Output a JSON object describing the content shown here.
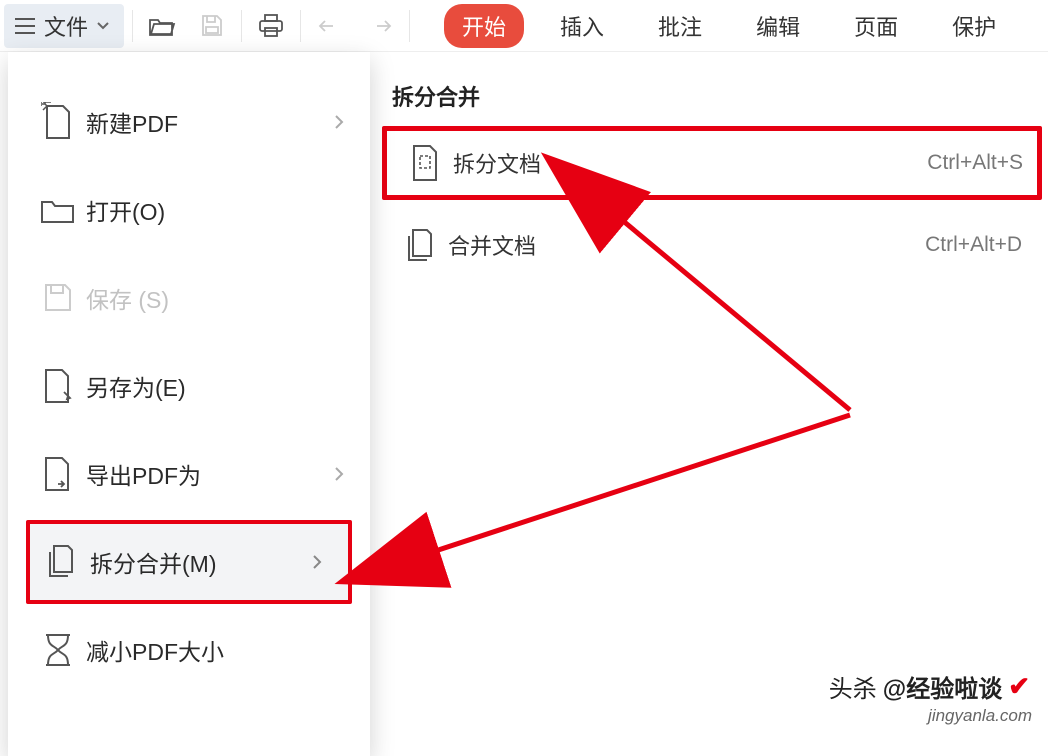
{
  "toolbar": {
    "file_label": "文件"
  },
  "tabs": {
    "start": "开始",
    "insert": "插入",
    "annotate": "批注",
    "edit": "编辑",
    "page": "页面",
    "protect": "保护"
  },
  "file_menu": {
    "new_pdf": "新建PDF",
    "open": "打开(O)",
    "save": "保存 (S)",
    "save_as": "另存为(E)",
    "export_as": "导出PDF为",
    "split_merge": "拆分合并(M)",
    "reduce_size": "减小PDF大小"
  },
  "submenu": {
    "title": "拆分合并",
    "split": {
      "label": "拆分文档",
      "shortcut": "Ctrl+Alt+S"
    },
    "merge": {
      "label": "合并文档",
      "shortcut": "Ctrl+Alt+D"
    }
  },
  "watermark": {
    "line1_prefix": "头杀 ",
    "line1_handle": "@经验啦谈",
    "line2": "jingyanla.com"
  }
}
